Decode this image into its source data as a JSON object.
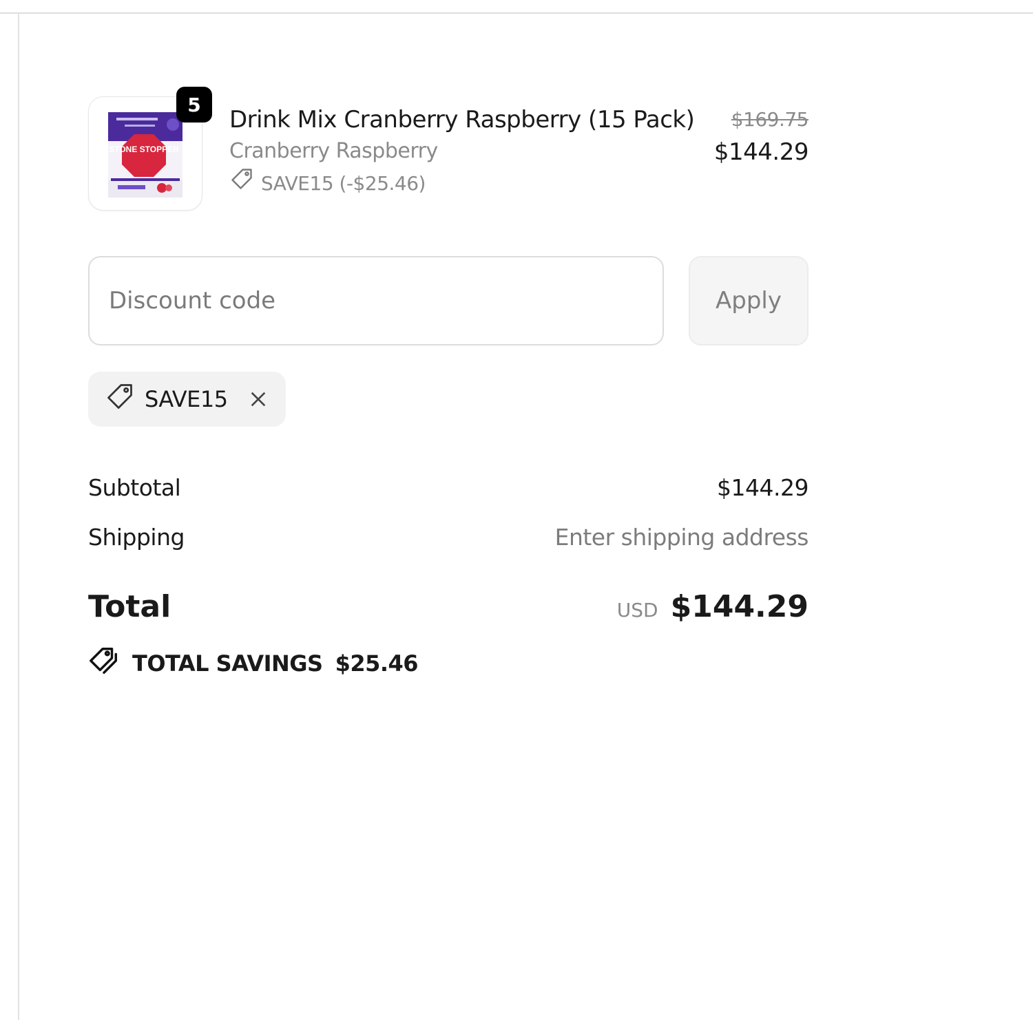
{
  "line_item": {
    "quantity": "5",
    "title": "Drink Mix Cranberry Raspberry (15 Pack)",
    "variant": "Cranberry Raspberry",
    "discount": "SAVE15 (-$25.46)",
    "original_price": "$169.75",
    "final_price": "$144.29",
    "image_text": "STONE STOPPER",
    "tag_icon": "tag-icon"
  },
  "discount_form": {
    "placeholder": "Discount code",
    "apply_label": "Apply"
  },
  "applied_code": {
    "code": "SAVE15",
    "icon": "tag-icon",
    "remove_icon": "close-icon"
  },
  "summary": {
    "subtotal_label": "Subtotal",
    "subtotal_value": "$144.29",
    "shipping_label": "Shipping",
    "shipping_value": "Enter shipping address",
    "total_label": "Total",
    "currency": "USD",
    "total_value": "$144.29",
    "savings_label": "TOTAL SAVINGS",
    "savings_value": "$25.46",
    "savings_icon": "tags-icon"
  },
  "colors": {
    "badge": "#000000",
    "muted_text": "#7c7c7c",
    "chip_background": "#f2f2f2",
    "product_purple": "#4b2a9c",
    "product_red": "#d7263d"
  }
}
